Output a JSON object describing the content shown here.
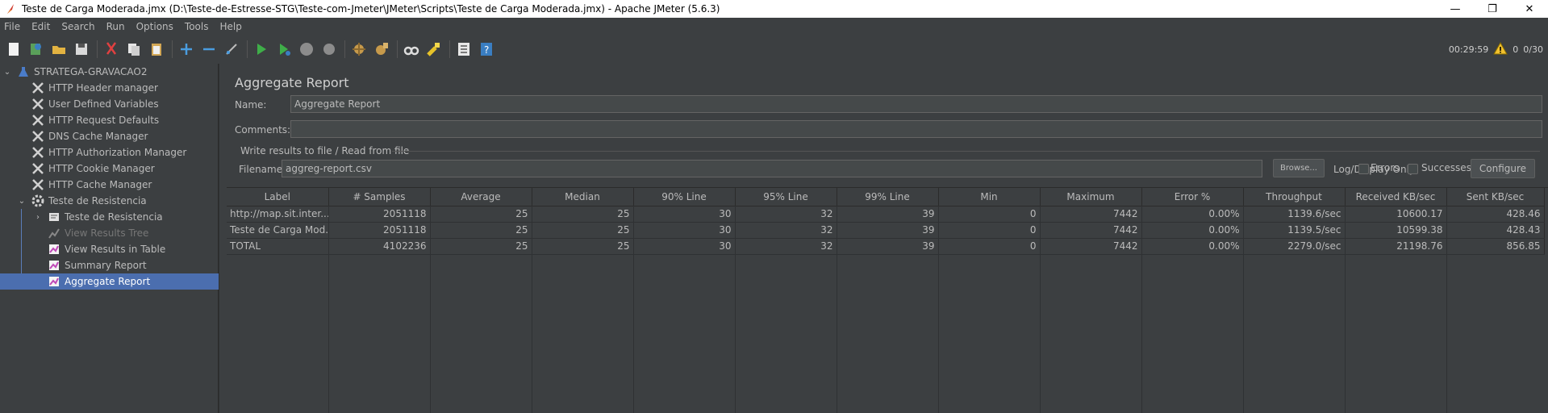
{
  "window": {
    "title": "Teste de Carga Moderada.jmx (D:\\Teste-de-Estresse-STG\\Teste-com-Jmeter\\JMeter\\Scripts\\Teste de Carga Moderada.jmx) - Apache JMeter (5.6.3)",
    "minimize": "—",
    "restore": "❐",
    "close": "✕"
  },
  "menu": [
    "File",
    "Edit",
    "Search",
    "Run",
    "Options",
    "Tools",
    "Help"
  ],
  "toolbar_status": {
    "elapsed": "00:29:59",
    "warnings": "0",
    "threads": "0/30"
  },
  "tree": {
    "root": "STRATEGA-GRAVACAO2",
    "items": [
      "HTTP Header manager",
      "User Defined Variables",
      "HTTP Request Defaults",
      "DNS Cache Manager",
      "HTTP Authorization Manager",
      "HTTP Cookie Manager",
      "HTTP Cache Manager"
    ],
    "thread_group": "Teste de Resistencia",
    "children": [
      "Teste de Resistencia",
      "View Results Tree",
      "View Results in Table",
      "Summary Report",
      "Aggregate Report"
    ]
  },
  "panel": {
    "title": "Aggregate Report",
    "name_label": "Name:",
    "name_value": "Aggregate Report",
    "comments_label": "Comments:",
    "comments_value": "",
    "file_group": "Write results to file / Read from file",
    "filename_label": "Filename",
    "filename_value": "aggreg-report.csv",
    "browse": "Browse...",
    "log_only": "Log/Display Only:",
    "errors": "Errors",
    "successes": "Successes",
    "configure": "Configure"
  },
  "table": {
    "headers": [
      "Label",
      "# Samples",
      "Average",
      "Median",
      "90% Line",
      "95% Line",
      "99% Line",
      "Min",
      "Maximum",
      "Error %",
      "Throughput",
      "Received KB/sec",
      "Sent KB/sec"
    ],
    "rows": [
      [
        "http://map.sit.inter...",
        "2051118",
        "25",
        "25",
        "30",
        "32",
        "39",
        "0",
        "7442",
        "0.00%",
        "1139.6/sec",
        "10600.17",
        "428.46"
      ],
      [
        "Teste de Carga Mod...",
        "2051118",
        "25",
        "25",
        "30",
        "32",
        "39",
        "0",
        "7442",
        "0.00%",
        "1139.5/sec",
        "10599.38",
        "428.43"
      ],
      [
        "TOTAL",
        "4102236",
        "25",
        "25",
        "30",
        "32",
        "39",
        "0",
        "7442",
        "0.00%",
        "2279.0/sec",
        "21198.76",
        "856.85"
      ]
    ]
  }
}
